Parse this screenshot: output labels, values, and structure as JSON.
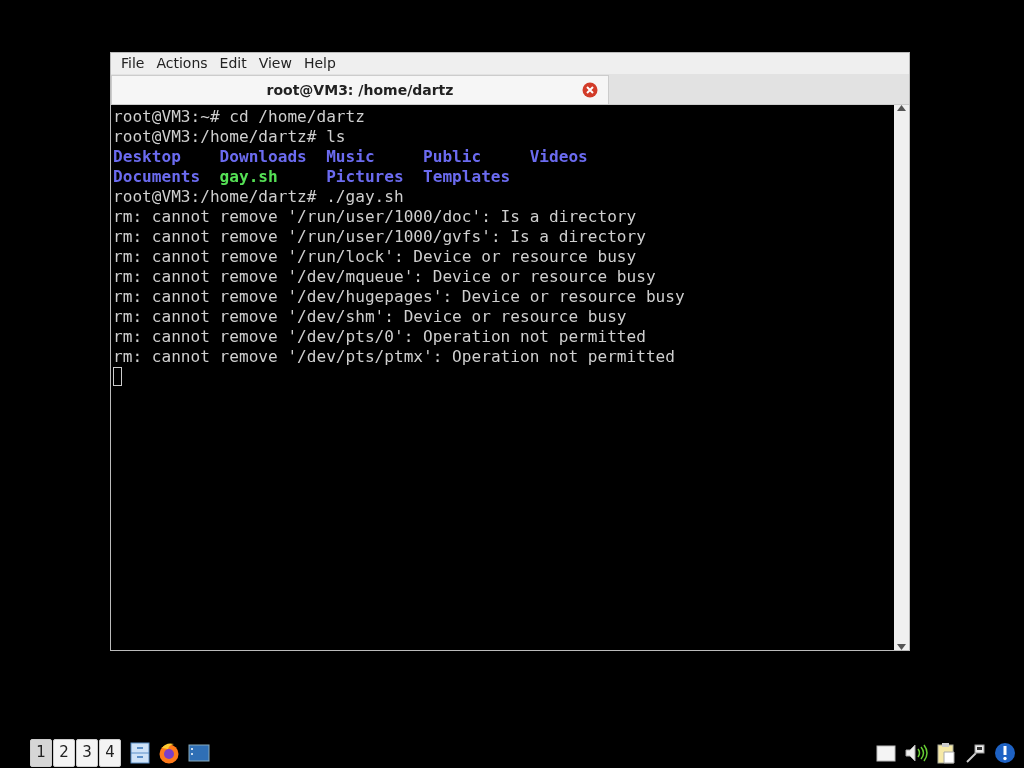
{
  "menu": [
    "File",
    "Actions",
    "Edit",
    "View",
    "Help"
  ],
  "tabs": [
    {
      "title": "root@VM3: /home/dartz",
      "selected": true
    }
  ],
  "terminal": {
    "lines": [
      {
        "kind": "text",
        "text": "root@VM3:~# cd /home/dartz"
      },
      {
        "kind": "text",
        "text": "root@VM3:/home/dartz# ls"
      },
      {
        "kind": "ls",
        "entries": [
          {
            "name": "Desktop",
            "kind": "dir"
          },
          {
            "name": "Downloads",
            "kind": "dir"
          },
          {
            "name": "Music",
            "kind": "dir"
          },
          {
            "name": "Public",
            "kind": "dir"
          },
          {
            "name": "Videos",
            "kind": "dir"
          }
        ]
      },
      {
        "kind": "ls",
        "entries": [
          {
            "name": "Documents",
            "kind": "dir"
          },
          {
            "name": "gay.sh",
            "kind": "exec"
          },
          {
            "name": "Pictures",
            "kind": "dir"
          },
          {
            "name": "Templates",
            "kind": "dir"
          }
        ]
      },
      {
        "kind": "text",
        "text": "root@VM3:/home/dartz# ./gay.sh"
      },
      {
        "kind": "text",
        "text": "rm: cannot remove '/run/user/1000/doc': Is a directory"
      },
      {
        "kind": "text",
        "text": "rm: cannot remove '/run/user/1000/gvfs': Is a directory"
      },
      {
        "kind": "text",
        "text": "rm: cannot remove '/run/lock': Device or resource busy"
      },
      {
        "kind": "text",
        "text": "rm: cannot remove '/dev/mqueue': Device or resource busy"
      },
      {
        "kind": "text",
        "text": "rm: cannot remove '/dev/hugepages': Device or resource busy"
      },
      {
        "kind": "text",
        "text": "rm: cannot remove '/dev/shm': Device or resource busy"
      },
      {
        "kind": "text",
        "text": "rm: cannot remove '/dev/pts/0': Operation not permitted"
      },
      {
        "kind": "text",
        "text": "rm: cannot remove '/dev/pts/ptmx': Operation not permitted"
      }
    ],
    "cursor": true
  },
  "taskbar": {
    "workspaces": [
      {
        "label": "1",
        "selected": true
      },
      {
        "label": "2",
        "selected": false
      },
      {
        "label": "3",
        "selected": false
      },
      {
        "label": "4",
        "selected": false
      }
    ]
  }
}
